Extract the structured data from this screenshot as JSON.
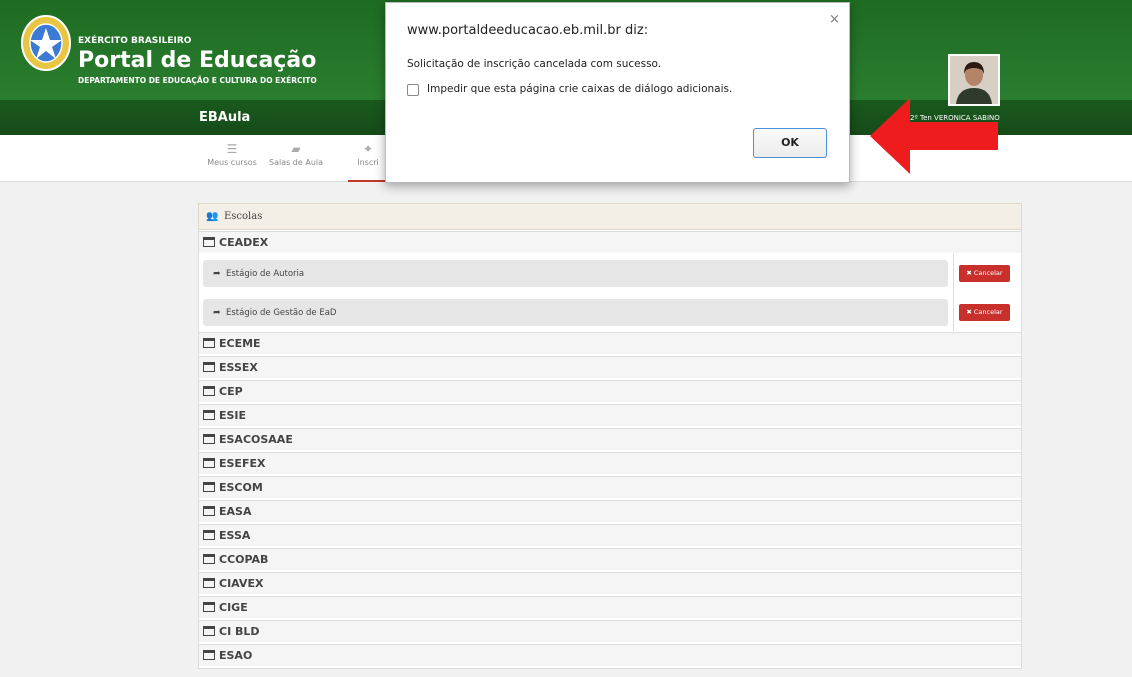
{
  "header": {
    "brand_top": "EXÉRCITO BRASILEIRO",
    "brand_title": "Portal de Educação",
    "brand_sub": "DEPARTAMENTO DE EDUCAÇÃO E CULTURA DO EXÉRCITO",
    "app_title": "EBAula",
    "user_name": "2º Ten VERONICA SABINO"
  },
  "nav": {
    "items": [
      {
        "label": "Meus cursos",
        "icon": "list-icon"
      },
      {
        "label": "Salas de Aula",
        "icon": "book-icon"
      },
      {
        "label": "Inscri",
        "icon": "pin-icon"
      }
    ]
  },
  "panel": {
    "title": "Escolas",
    "schools": [
      {
        "name": "CEADEX",
        "courses": [
          {
            "name": "Estágio de Autoria",
            "action": "Cancelar"
          },
          {
            "name": "Estágio de Gestão de EaD",
            "action": "Cancelar"
          }
        ]
      },
      {
        "name": "ECEME"
      },
      {
        "name": "ESSEX"
      },
      {
        "name": "CEP"
      },
      {
        "name": "ESIE"
      },
      {
        "name": "ESACOSAAE"
      },
      {
        "name": "ESEFEX"
      },
      {
        "name": "ESCOM"
      },
      {
        "name": "EASA"
      },
      {
        "name": "ESSA"
      },
      {
        "name": "CCOPAB"
      },
      {
        "name": "CIAVEX"
      },
      {
        "name": "CIGE"
      },
      {
        "name": "CI BLD"
      },
      {
        "name": "ESAO"
      }
    ]
  },
  "dialog": {
    "title": "www.portaldeeducacao.eb.mil.br diz:",
    "message": "Solicitação de inscrição cancelada com sucesso.",
    "checkbox_label": "Impedir que esta página crie caixas de diálogo adicionais.",
    "ok_label": "OK",
    "close_symbol": "×"
  },
  "colors": {
    "header_green": "#2a7e2f",
    "cancel_red": "#c9302c",
    "annotation_arrow": "#ee1c1c"
  }
}
